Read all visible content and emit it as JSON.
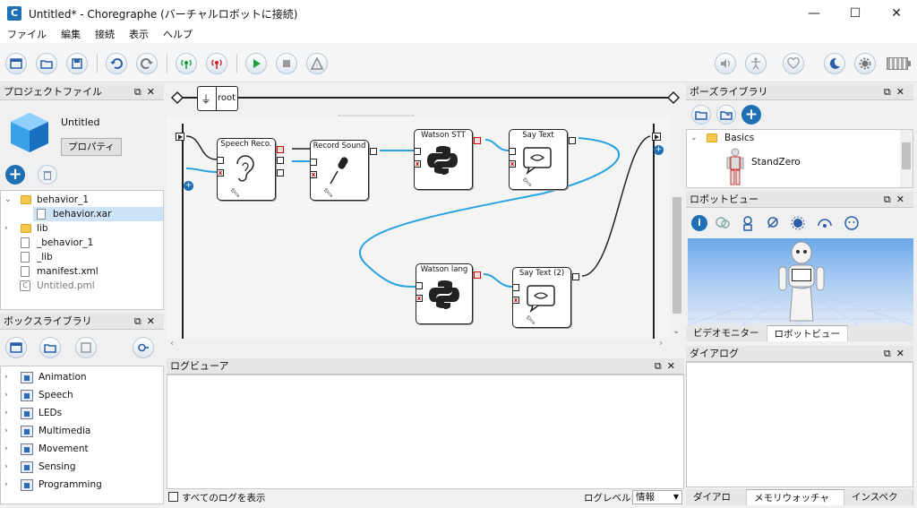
{
  "window": {
    "title": "Untitled* - Choregraphe (バーチャルロボットに接続)",
    "app_icon_letter": "C",
    "controls": [
      "—",
      "☐",
      "✕"
    ]
  },
  "menu": [
    "ファイル",
    "編集",
    "接続",
    "表示",
    "ヘルプ"
  ],
  "toolbar": {
    "status_label": "停止"
  },
  "project_panel": {
    "title": "プロジェクトファイル",
    "project_name": "Untitled",
    "properties_button": "プロパティ",
    "tree": [
      {
        "label": "behavior_1",
        "type": "folder",
        "expanded": true
      },
      {
        "label": "behavior.xar",
        "type": "file",
        "selected": true
      },
      {
        "label": "lib",
        "type": "folder"
      },
      {
        "label": "_behavior_1",
        "type": "file"
      },
      {
        "label": "_lib",
        "type": "file"
      },
      {
        "label": "manifest.xml",
        "type": "file"
      },
      {
        "label": "Untitled.pml",
        "type": "pml"
      }
    ]
  },
  "box_library": {
    "title": "ボックスライブラリ",
    "items": [
      "Animation",
      "Speech",
      "LEDs",
      "Multimedia",
      "Movement",
      "Sensing",
      "Programming"
    ]
  },
  "flow": {
    "root_label": "root",
    "nodes": {
      "speech_reco": "Speech Reco.",
      "record_sound": "Record Sound",
      "watson_stt": "Watson STT",
      "say_text": "Say Text",
      "watson_lang": "Watson lang",
      "say_text_2": "Say Text (2)"
    }
  },
  "log_viewer": {
    "title": "ログビューア",
    "show_all_label": "すべてのログを表示",
    "level_label": "ログレベル:",
    "level_value": "情報"
  },
  "pose_library": {
    "title": "ポーズライブラリ",
    "folder": "Basics",
    "pose": "StandZero"
  },
  "robot_view": {
    "title": "ロボットビュー",
    "tabs": [
      "ビデオモニター",
      "ロボットビュー"
    ]
  },
  "dialog": {
    "title": "ダイアログ",
    "tabs": [
      "ダイアログ",
      "メモリウォッチャー",
      "インスペクタ"
    ]
  },
  "colors": {
    "accent_blue": "#1f6fb5",
    "wire_blue": "#29a3e0",
    "robot_bg": "#8fb8ee"
  }
}
